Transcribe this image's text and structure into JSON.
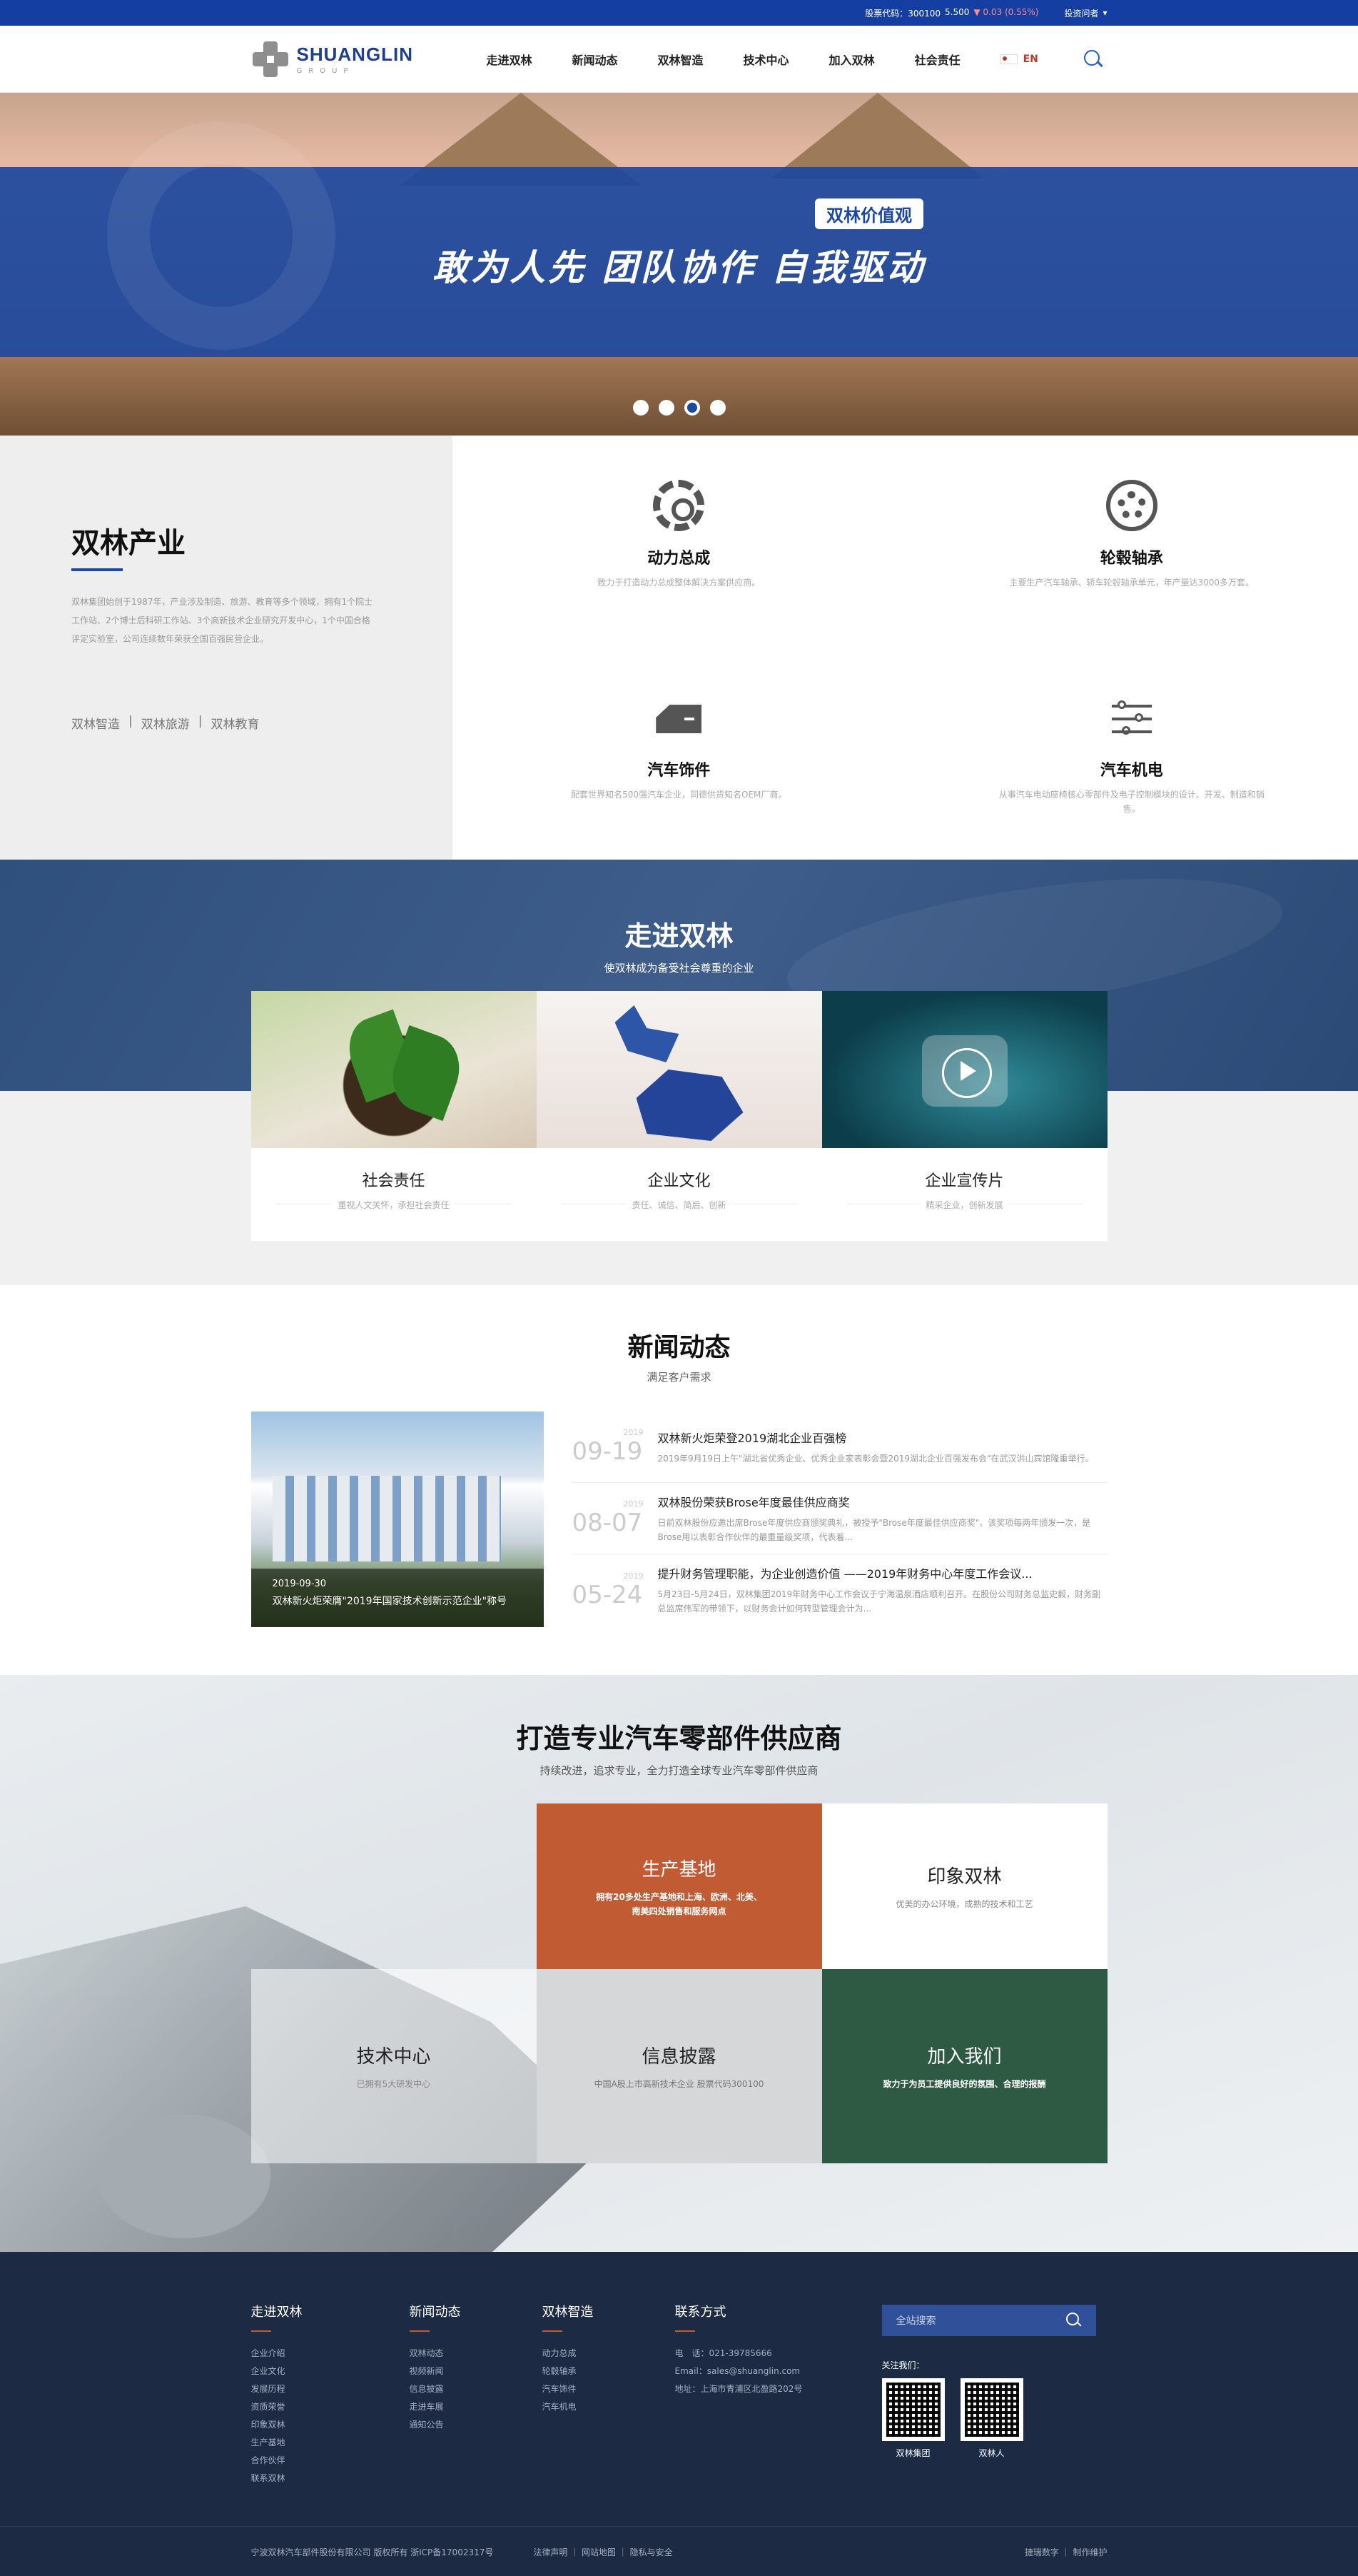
{
  "topbar": {
    "stock_label": "股票代码：300100",
    "price": "5.500",
    "change": "0.03 (0.55%)",
    "investor": "投资问者"
  },
  "header": {
    "logo_name": "SHUANGLIN",
    "logo_group": "GROUP",
    "nav": [
      "走进双林",
      "新闻动态",
      "双林智造",
      "技术中心",
      "加入双林",
      "社会责任"
    ],
    "lang": "EN"
  },
  "banner": {
    "tag": "双林价值观",
    "slogan": "敢为人先 团队协作 自我驱动",
    "slides": 4,
    "active_slide": 3
  },
  "industry": {
    "title": "双林产业",
    "desc": "双林集团始创于1987年，产业涉及制造、旅游、教育等多个领域，拥有1个院士工作站、2个博士后科研工作站、3个高新技术企业研究开发中心，1个中国合格评定实验室，公司连续数年荣获全国百强民营企业。",
    "links": [
      "双林智造",
      "双林旅游",
      "双林教育"
    ],
    "items": [
      {
        "title": "动力总成",
        "desc": "致力于打造动力总成整体解决方案供应商。"
      },
      {
        "title": "轮毂轴承",
        "desc": "主要生产汽车轴承、轿车轮毂轴承单元，年产量达3000多万套。"
      },
      {
        "title": "汽车饰件",
        "desc": "配套世界知名500强汽车企业，同德供货知名OEM厂商。"
      },
      {
        "title": "汽车机电",
        "desc": "从事汽车电动座椅核心零部件及电子控制模块的设计、开发、制造和销售。"
      }
    ]
  },
  "about": {
    "title": "走进双林",
    "subtitle": "使双林成为备受社会尊重的企业",
    "cards": [
      {
        "title": "社会责任",
        "sub": "重视人文关怀，承担社会责任"
      },
      {
        "title": "企业文化",
        "sub": "责任、诚信、简后、创新"
      },
      {
        "title": "企业宣传片",
        "sub": "精采企业，创新发展"
      }
    ]
  },
  "news": {
    "title": "新闻动态",
    "subtitle": "满足客户需求",
    "feature": {
      "date": "2019-09-30",
      "caption": "双林新火炬荣膺\"2019年国家技术创新示范企业\"称号"
    },
    "items": [
      {
        "year": "2019",
        "md": "09-19",
        "title": "双林新火炬荣登2019湖北企业百强榜",
        "desc": "2019年9月19日上午\"湖北省优秀企业、优秀企业家表彰会暨2019湖北企业百强发布会\"在武汉洪山宾馆隆重举行。"
      },
      {
        "year": "2019",
        "md": "08-07",
        "title": "双林股份荣获Brose年度最佳供应商奖",
        "desc": "日前双林股份应邀出席Brose年度供应商颁奖典礼，被授予\"Brose年度最佳供应商奖\"。该奖项每两年颁发一次，是Brose用以表彰合作伙伴的最重量级奖项，代表着..."
      },
      {
        "year": "2019",
        "md": "05-24",
        "title": "提升财务管理职能，为企业创造价值 ——2019年财务中心年度工作会议...",
        "desc": "5月23日-5月24日，双林集团2019年财务中心工作会议于宁海温泉酒店顺利召开。在股份公司财务总监史毅，财务副总监席伟军的带领下，以财务会计如何转型管理会计为..."
      }
    ]
  },
  "supplier": {
    "title": "打造专业汽车零部件供应商",
    "subtitle": "持续改进，追求专业，全力打造全球专业汽车零部件供应商",
    "tiles": [
      {
        "title": "生产基地",
        "desc": "拥有20多处生产基地和上海、欧洲、北美、南美四处销售和服务网点"
      },
      {
        "title": "印象双林",
        "desc": "优美的办公环境，成熟的技术和工艺"
      },
      {
        "title": "技术中心",
        "desc": "已拥有5大研发中心"
      },
      {
        "title": "信息披露",
        "desc": "中国A股上市高新技术企业 股票代码300100"
      },
      {
        "title": "加入我们",
        "desc": "致力于为员工提供良好的氛围、合理的报酬"
      }
    ]
  },
  "footer": {
    "cols": [
      {
        "title": "走进双林",
        "items": [
          "企业介绍",
          "企业文化",
          "发展历程",
          "资质荣誉",
          "印象双林",
          "生产基地",
          "合作伙伴",
          "联系双林"
        ]
      },
      {
        "title": "新闻动态",
        "items": [
          "双林动态",
          "视频新闻",
          "信息披露",
          "走进车展",
          "通知公告"
        ]
      },
      {
        "title": "双林智造",
        "items": [
          "动力总成",
          "轮毂轴承",
          "汽车饰件",
          "汽车机电"
        ]
      },
      {
        "title": "联系方式",
        "items": [
          "电　话：021-39785666",
          "Email：sales@shuanglin.com",
          "地址：上海市青浦区北盈路202号"
        ]
      }
    ],
    "search_placeholder": "全站搜索",
    "follow": "关注我们：",
    "qrs": [
      "双林集团",
      "双林人"
    ],
    "copyright": "宁波双林汽车部件股份有限公司  版权所有  浙ICP备17002317号",
    "links": "法律声明 ｜ 网站地图 ｜ 隐私与安全",
    "credit": "捷瑞数字 ｜ 制作维护"
  }
}
